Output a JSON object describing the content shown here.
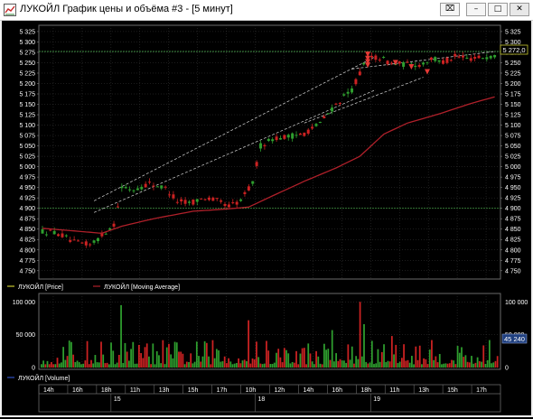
{
  "window": {
    "title": "ЛУКОЙЛ График цены и объёма #3 - [5 минут]",
    "buttons": {
      "extra": "⌧",
      "minimize": "–",
      "maximize": "□",
      "close": "✕"
    }
  },
  "colors": {
    "background": "#000000",
    "grid": "#3a3a3a",
    "candle_up": "#2e9e2e",
    "candle_down": "#cc2222",
    "moving_average": "#b0202a",
    "channel": "#d8d8d8",
    "level_line": "#4caf50",
    "axis_text": "#ffffff",
    "price_tag_bg": "#000000",
    "volume_tag_bg": "#1f3f7f"
  },
  "price_panel": {
    "y_ticks": [
      "5 325",
      "5 300",
      "5 275",
      "5 250",
      "5 225",
      "5 200",
      "5 175",
      "5 150",
      "5 125",
      "5 100",
      "5 075",
      "5 050",
      "5 025",
      "5 000",
      "4 975",
      "4 950",
      "4 925",
      "4 900",
      "4 875",
      "4 850",
      "4 825",
      "4 800",
      "4 775",
      "4 750"
    ],
    "current_price_label": "5 272,0",
    "legend": [
      {
        "label": "ЛУКОЙЛ [Price]",
        "color": "#c8c830"
      },
      {
        "label": "ЛУКОЙЛ [Moving Average]",
        "color": "#b0202a"
      }
    ]
  },
  "volume_panel": {
    "y_ticks_left": [
      "100 000",
      "50 000",
      "0"
    ],
    "y_ticks_right": [
      "100 000",
      "50 000",
      "0"
    ],
    "current_volume_label": "45 240",
    "legend": [
      {
        "label": "ЛУКОЙЛ [Volume]",
        "color": "#3050c0"
      }
    ]
  },
  "time_axis": {
    "hours": [
      "14h",
      "16h",
      "18h",
      "11h",
      "13h",
      "15h",
      "17h",
      "10h",
      "12h",
      "14h",
      "16h",
      "18h",
      "11h",
      "13h",
      "15h",
      "17h"
    ],
    "dates": [
      "15",
      "18",
      "19"
    ]
  },
  "chart_data": {
    "type": "candlestick",
    "title": "",
    "ylabel": "",
    "ylim": [
      4730,
      5340
    ],
    "ylim_volume": [
      0,
      110000
    ],
    "series": [
      {
        "name": "ЛУКОЙЛ [Price]",
        "anchors": [
          [
            0,
            4845
          ],
          [
            4,
            4840
          ],
          [
            8,
            4818
          ],
          [
            12,
            4812
          ],
          [
            15,
            4835
          ],
          [
            18,
            4862
          ],
          [
            20,
            4950
          ],
          [
            23,
            4945
          ],
          [
            27,
            4960
          ],
          [
            31,
            4948
          ],
          [
            34,
            4918
          ],
          [
            37,
            4913
          ],
          [
            41,
            4925
          ],
          [
            44,
            4918
          ],
          [
            47,
            4905
          ],
          [
            50,
            4918
          ],
          [
            53,
            4962
          ],
          [
            55,
            5050
          ],
          [
            58,
            5068
          ],
          [
            62,
            5072
          ],
          [
            66,
            5080
          ],
          [
            70,
            5105
          ],
          [
            74,
            5150
          ],
          [
            78,
            5185
          ],
          [
            80,
            5225
          ],
          [
            82,
            5262
          ],
          [
            85,
            5262
          ],
          [
            88,
            5248
          ],
          [
            92,
            5246
          ],
          [
            95,
            5245
          ],
          [
            98,
            5260
          ],
          [
            101,
            5252
          ],
          [
            104,
            5264
          ],
          [
            107,
            5260
          ],
          [
            110,
            5262
          ],
          [
            114,
            5268
          ]
        ]
      },
      {
        "name": "ЛУКОЙЛ [Moving Average]",
        "anchors": [
          [
            0,
            4852
          ],
          [
            15,
            4840
          ],
          [
            20,
            4857
          ],
          [
            28,
            4875
          ],
          [
            38,
            4893
          ],
          [
            46,
            4898
          ],
          [
            52,
            4903
          ],
          [
            58,
            4930
          ],
          [
            66,
            4965
          ],
          [
            74,
            4997
          ],
          [
            80,
            5025
          ],
          [
            86,
            5078
          ],
          [
            92,
            5105
          ],
          [
            100,
            5127
          ],
          [
            108,
            5152
          ],
          [
            114,
            5168
          ]
        ]
      }
    ],
    "channel": {
      "upper": [
        [
          13,
          4918
        ],
        [
          84,
          5265
        ]
      ],
      "lower": [
        [
          13,
          4890
        ],
        [
          84,
          5185
        ]
      ],
      "upper_ext": [
        [
          78,
          5235
        ],
        [
          114,
          5277
        ]
      ],
      "lower_ext": [
        [
          66,
          5105
        ],
        [
          96,
          5215
        ]
      ]
    },
    "levels": [
      5277,
      4900
    ],
    "volume_series": {
      "name": "ЛУКОЙЛ [Volume]",
      "last": 45240
    }
  }
}
